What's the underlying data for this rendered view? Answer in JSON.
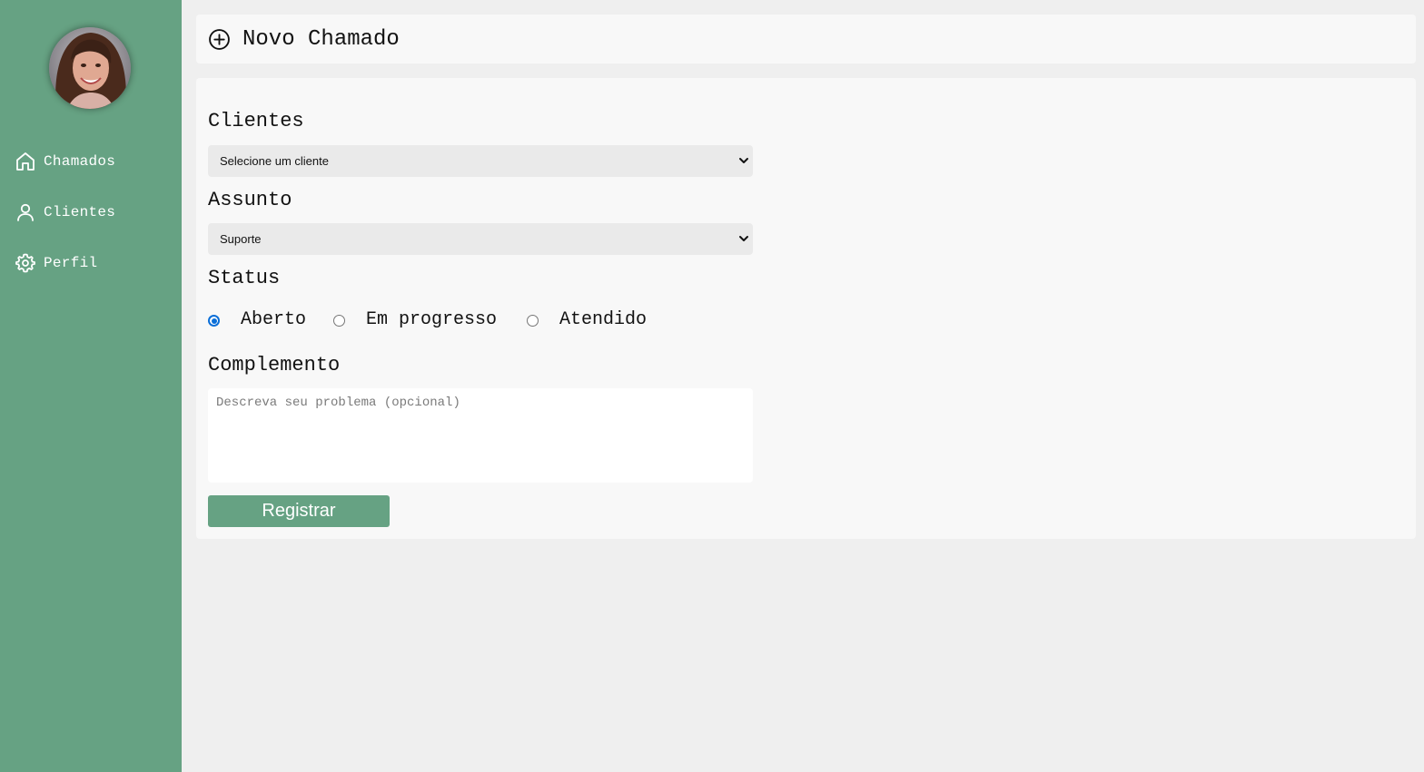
{
  "colors": {
    "sidebar": "#66a283",
    "page_background": "#efefef",
    "panel_background": "#f8f8f8",
    "button": "#66a283",
    "radio_accent": "#0b6fd8"
  },
  "sidebar": {
    "avatar_icon": "user-photo",
    "items": [
      {
        "label": "Chamados",
        "icon": "home-icon"
      },
      {
        "label": "Clientes",
        "icon": "user-icon"
      },
      {
        "label": "Perfil",
        "icon": "gear-icon"
      }
    ]
  },
  "header": {
    "title": "Novo Chamado",
    "icon": "plus-circle-icon"
  },
  "form": {
    "clientes": {
      "label": "Clientes",
      "selected": "Selecione um cliente"
    },
    "assunto": {
      "label": "Assunto",
      "selected": "Suporte"
    },
    "status": {
      "label": "Status",
      "options": [
        "Aberto",
        "Em progresso",
        "Atendido"
      ],
      "selected": "Aberto"
    },
    "complemento": {
      "label": "Complemento",
      "placeholder": "Descreva seu problema (opcional)",
      "value": ""
    },
    "submit_label": "Registrar"
  }
}
